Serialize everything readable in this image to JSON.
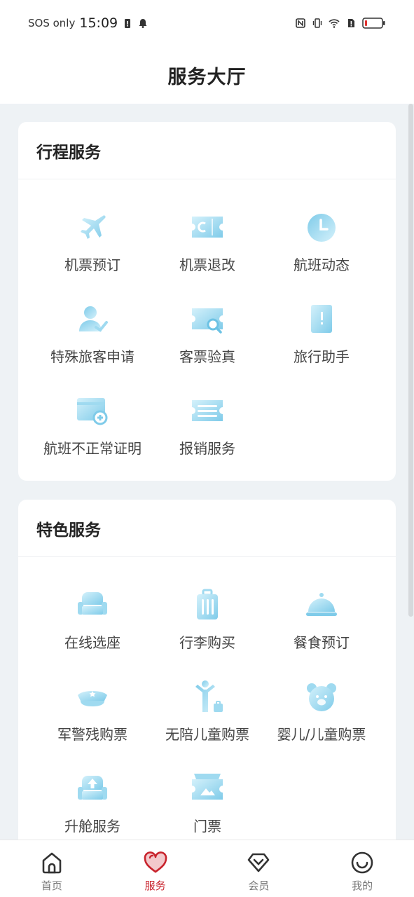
{
  "status_bar": {
    "carrier": "SOS only",
    "time": "15:09"
  },
  "header": {
    "title": "服务大厅"
  },
  "sections": [
    {
      "title": "行程服务",
      "items": [
        {
          "label": "机票预订",
          "icon": "airplane-icon"
        },
        {
          "label": "机票退改",
          "icon": "ticket-change-icon"
        },
        {
          "label": "航班动态",
          "icon": "clock-icon"
        },
        {
          "label": "特殊旅客申请",
          "icon": "special-passenger-icon"
        },
        {
          "label": "客票验真",
          "icon": "ticket-search-icon"
        },
        {
          "label": "旅行助手",
          "icon": "travel-book-icon"
        },
        {
          "label": "航班不正常证明",
          "icon": "certificate-icon"
        },
        {
          "label": "报销服务",
          "icon": "reimbursement-icon"
        }
      ]
    },
    {
      "title": "特色服务",
      "items": [
        {
          "label": "在线选座",
          "icon": "seat-icon"
        },
        {
          "label": "行李购买",
          "icon": "luggage-icon"
        },
        {
          "label": "餐食预订",
          "icon": "meal-cloche-icon"
        },
        {
          "label": "军警残购票",
          "icon": "police-cap-icon"
        },
        {
          "label": "无陪儿童购票",
          "icon": "unaccompanied-child-icon"
        },
        {
          "label": "婴儿/儿童购票",
          "icon": "bear-icon"
        },
        {
          "label": "升舱服务",
          "icon": "upgrade-seat-icon"
        },
        {
          "label": "门票",
          "icon": "admission-ticket-icon"
        }
      ]
    }
  ],
  "tabbar": [
    {
      "label": "首页",
      "icon": "home-icon",
      "active": false
    },
    {
      "label": "服务",
      "icon": "heart-icon",
      "active": true
    },
    {
      "label": "会员",
      "icon": "member-icon",
      "active": false
    },
    {
      "label": "我的",
      "icon": "smile-icon",
      "active": false
    }
  ],
  "colors": {
    "accent": "#c8232c",
    "icon_light": "#c9ecf8",
    "icon_mid": "#86d0ec",
    "background": "#eef2f5"
  }
}
